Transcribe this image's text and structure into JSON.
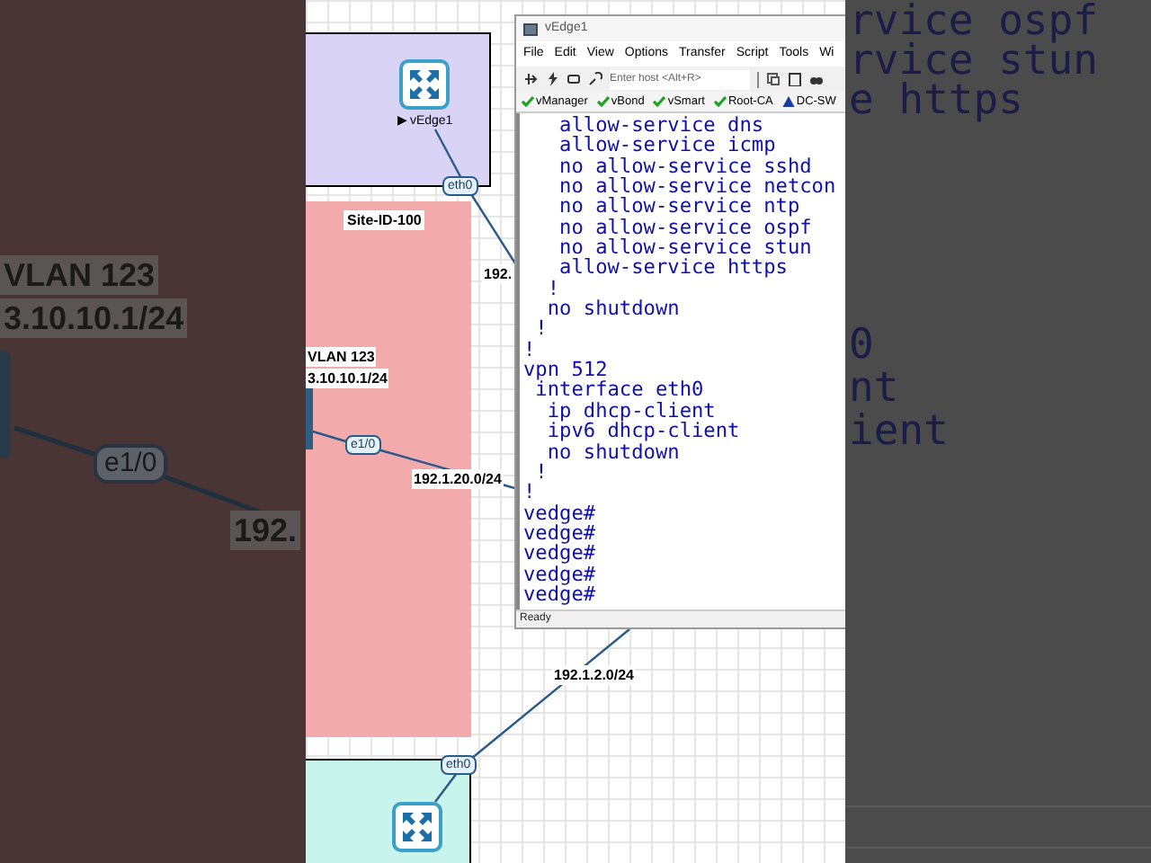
{
  "backdrop_left": {
    "labels": [
      "VLAN 123",
      "3.10.10.1/24",
      "192."
    ],
    "port": "e1/0"
  },
  "backdrop_right": {
    "lines": [
      "rvice ospf",
      "rvice stun",
      "e https",
      "0",
      "nt",
      "ient"
    ]
  },
  "topology": {
    "sites": [
      {
        "color": "#d9d3f5"
      },
      {
        "label": "Site-ID-100",
        "color": "#f2aaaa"
      },
      {
        "color": "#c8f4ee"
      }
    ],
    "nodes": [
      {
        "name": "▶ vEdge1"
      }
    ],
    "ports": [
      "eth0",
      "e1/0",
      "eth0"
    ],
    "labels": [
      "VLAN 123",
      "3.10.10.1/24",
      "192.",
      "192.1.20.0/24",
      "192.1.2.0/24"
    ]
  },
  "terminal": {
    "title": "vEdge1",
    "menu": [
      "File",
      "Edit",
      "View",
      "Options",
      "Transfer",
      "Script",
      "Tools",
      "Wi"
    ],
    "host_placeholder": "Enter host <Alt+R>",
    "buttons": [
      {
        "label": "vManager",
        "kind": "ok"
      },
      {
        "label": "vBond",
        "kind": "ok"
      },
      {
        "label": "vSmart",
        "kind": "ok"
      },
      {
        "label": "Root-CA",
        "kind": "ok"
      },
      {
        "label": "DC-SW",
        "kind": "warning"
      }
    ],
    "lines": [
      "   allow-service dns",
      "   allow-service icmp",
      "   no allow-service sshd",
      "   no allow-service netcon",
      "   no allow-service ntp",
      "   no allow-service ospf",
      "   no allow-service stun",
      "   allow-service https",
      "  !",
      "  no shutdown",
      " !",
      "!",
      "vpn 512",
      " interface eth0",
      "  ip dhcp-client",
      "  ipv6 dhcp-client",
      "  no shutdown",
      " !",
      "!",
      "vedge#",
      "vedge#",
      "vedge#",
      "vedge#",
      "vedge#"
    ],
    "status": "Ready"
  }
}
